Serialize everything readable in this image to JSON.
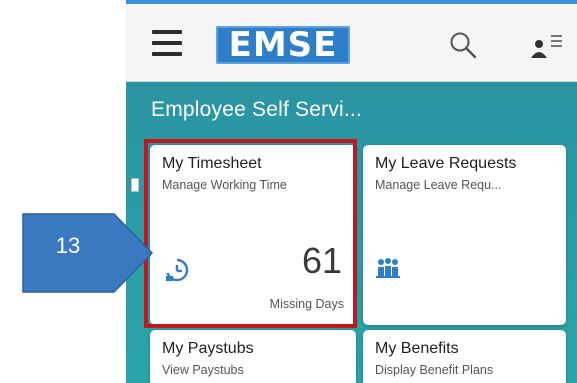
{
  "header": {
    "logo_text": "EMSE",
    "menu_icon": "hamburger-menu-icon",
    "search_icon": "search-icon",
    "profile_icon": "profile-list-icon",
    "accent_color": "#3b8fd6"
  },
  "section": {
    "title": "Employee Self Servi..."
  },
  "tiles": [
    {
      "title": "My Timesheet",
      "subtitle": "Manage Working Time",
      "icon": "timesheet-clock-icon",
      "number": "61",
      "unit": "Missing Days"
    },
    {
      "title": "My Leave Requests",
      "subtitle": "Manage Leave Requ...",
      "icon": "leave-people-icon"
    },
    {
      "title": "My Paystubs",
      "subtitle": "View Paystubs"
    },
    {
      "title": "My Benefits",
      "subtitle": "Display Benefit Plans"
    }
  ],
  "annotation": {
    "callout_label": "13",
    "callout_color": "#3b7ac0",
    "highlight_color": "#c2171d"
  }
}
